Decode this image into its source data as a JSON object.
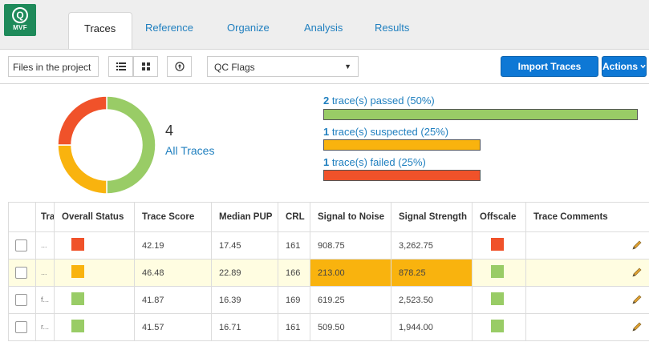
{
  "app": {
    "logo_text": "MVF",
    "logo_glyph": "Q",
    "tabs": [
      "Traces",
      "Reference",
      "Organize",
      "Analysis",
      "Results"
    ],
    "active_tab": "Traces"
  },
  "toolbar": {
    "files_label": "Files in the project",
    "qc_select": "QC Flags",
    "import_label": "Import Traces",
    "actions_label": "Actions",
    "icons": [
      "list-view-icon",
      "grid-view-icon",
      "upload-icon"
    ]
  },
  "summary": {
    "count": "4",
    "all_traces_label": "All Traces",
    "passed": {
      "count": "2",
      "text": " trace(s) passed (50%)",
      "fraction": 0.5,
      "color": "#99cc66"
    },
    "suspected": {
      "count": "1",
      "text": " trace(s) suspected (25%)",
      "fraction": 0.25,
      "color": "#f9b30e"
    },
    "failed": {
      "count": "1",
      "text": " trace(s) failed (25%)",
      "fraction": 0.25,
      "color": "#f0522a"
    }
  },
  "table": {
    "columns": [
      "Tra",
      "Overall Status",
      "Trace Score",
      "Median PUP",
      "CRL",
      "Signal to Noise",
      "Signal Strength",
      "Offscale",
      "Trace Comments"
    ],
    "rows": [
      {
        "name": "...",
        "status": "#f0522a",
        "score": "42.19",
        "pup": "17.45",
        "crl": "161",
        "snr": "908.75",
        "strength": "3,262.75",
        "offscale": "#f0522a",
        "highlight": false
      },
      {
        "name": "...",
        "status": "#f9b30e",
        "score": "46.48",
        "pup": "22.89",
        "crl": "166",
        "snr": "213.00",
        "strength": "878.25",
        "offscale": "#99cc66",
        "highlight": true
      },
      {
        "name": "f...",
        "status": "#99cc66",
        "score": "41.87",
        "pup": "16.39",
        "crl": "169",
        "snr": "619.25",
        "strength": "2,523.50",
        "offscale": "#99cc66",
        "highlight": false
      },
      {
        "name": "r...",
        "status": "#99cc66",
        "score": "41.57",
        "pup": "16.71",
        "crl": "161",
        "snr": "509.50",
        "strength": "1,944.00",
        "offscale": "#99cc66",
        "highlight": false
      }
    ]
  }
}
